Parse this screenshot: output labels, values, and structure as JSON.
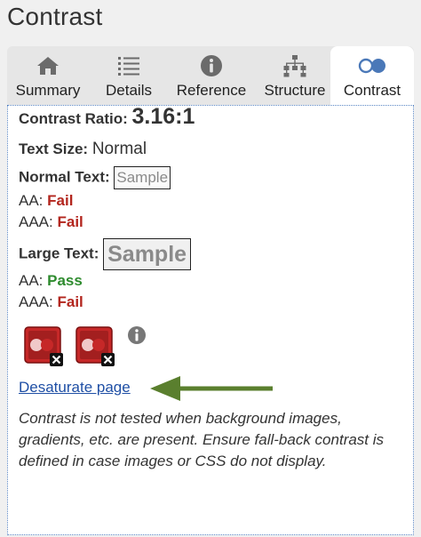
{
  "app": {
    "title": "Contrast"
  },
  "tabs": [
    {
      "label": "Summary",
      "icon": "home-icon"
    },
    {
      "label": "Details",
      "icon": "list-icon"
    },
    {
      "label": "Reference",
      "icon": "info-icon"
    },
    {
      "label": "Structure",
      "icon": "hierarchy-icon"
    },
    {
      "label": "Contrast",
      "icon": "contrast-icon",
      "active": true
    }
  ],
  "contrast": {
    "ratio_label": "Contrast Ratio:",
    "ratio_value": "3.16:1",
    "text_size_label": "Text Size:",
    "text_size_value": "Normal",
    "normal_text_label": "Normal Text:",
    "large_text_label": "Large Text:",
    "sample_text": "Sample",
    "normal": {
      "aa_label": "AA:",
      "aa_result": "Fail",
      "aaa_label": "AAA:",
      "aaa_result": "Fail"
    },
    "large": {
      "aa_label": "AA:",
      "aa_result": "Pass",
      "aaa_label": "AAA:",
      "aaa_result": "Fail"
    },
    "desaturate_link": "Desaturate page",
    "note": "Contrast is not tested when background images, gradients, etc. are present. Ensure fall-back contrast is defined in case images or CSS do not display."
  },
  "colors": {
    "fail": "#b3261e",
    "pass": "#2e8b2e",
    "link": "#1f4fa5",
    "arrow": "#5a7f2e",
    "swatch_red": "#c62828",
    "panel_border": "#5b87c5"
  }
}
